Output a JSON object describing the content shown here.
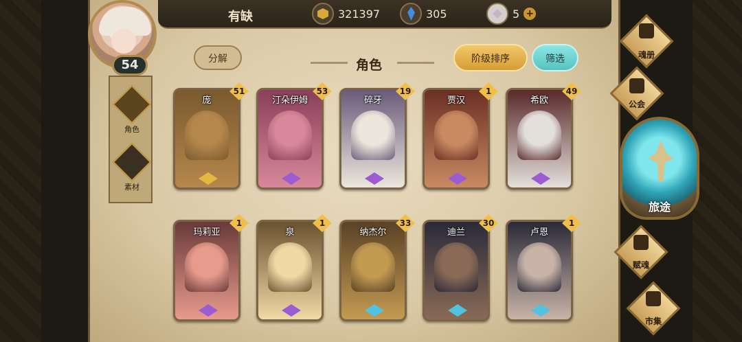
{
  "player": {
    "name": "有缺",
    "level": "54"
  },
  "currency": {
    "gold": "321397",
    "gems": "305",
    "crystals": "5",
    "add_symbol": "+"
  },
  "side_tabs": [
    {
      "label": "角色",
      "active": true
    },
    {
      "label": "素材",
      "active": false
    }
  ],
  "header": {
    "split_button": "分解",
    "title": "角色",
    "sort_button": "阶级排序",
    "filter_button": "筛选"
  },
  "characters": [
    {
      "name": "庞",
      "level": "51",
      "rank": "gold",
      "colors": [
        "#7a5a30",
        "#b5874c"
      ]
    },
    {
      "name": "汀朵伊姆",
      "level": "53",
      "rank": "purple",
      "colors": [
        "#8a3f5a",
        "#d7889a"
      ]
    },
    {
      "name": "碎牙",
      "level": "19",
      "rank": "purple",
      "colors": [
        "#6a5b7a",
        "#ece7dc"
      ]
    },
    {
      "name": "贾汉",
      "level": "1",
      "rank": "purple",
      "colors": [
        "#6a3024",
        "#c98a62"
      ]
    },
    {
      "name": "希欧",
      "level": "49",
      "rank": "purple",
      "colors": [
        "#5a2a2a",
        "#e3e0dc"
      ]
    },
    {
      "name": "玛莉亚",
      "level": "1",
      "rank": "purple",
      "colors": [
        "#6a3a3a",
        "#e79b8c"
      ]
    },
    {
      "name": "泉",
      "level": "1",
      "rank": "purple",
      "colors": [
        "#6a5230",
        "#f1d9a6"
      ]
    },
    {
      "name": "纳杰尔",
      "level": "33",
      "rank": "blue",
      "colors": [
        "#5a4226",
        "#c49a52"
      ]
    },
    {
      "name": "迪兰",
      "level": "30",
      "rank": "blue",
      "colors": [
        "#2a2a3a",
        "#8a6a56"
      ]
    },
    {
      "name": "卢恩",
      "level": "1",
      "rank": "blue",
      "colors": [
        "#2a2a38",
        "#c9b3a8"
      ]
    }
  ],
  "rank_colors": {
    "gold": "#e8b740",
    "purple": "#9b5bd1",
    "blue": "#4fc3e0"
  },
  "right_menu": {
    "soul_book": "魂册",
    "guild": "公会",
    "journey": "旅途",
    "endow_soul": "赋魂",
    "market": "市集"
  }
}
